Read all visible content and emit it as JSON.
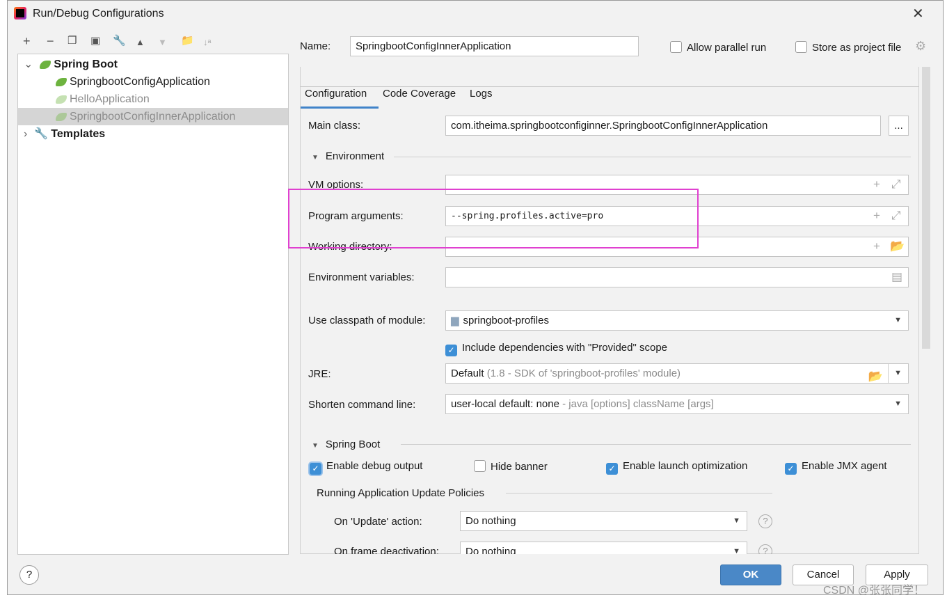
{
  "window": {
    "title": "Run/Debug Configurations"
  },
  "toolbar": [
    "add-icon",
    "remove-icon",
    "copy-icon",
    "save-icon",
    "wrench-icon",
    "move-up-icon",
    "move-down-icon",
    "new-folder-icon",
    "sort-icon"
  ],
  "tree": {
    "group": "Spring Boot",
    "items": [
      "SpringbootConfigApplication",
      "HelloApplication",
      "SpringbootConfigInnerApplication"
    ],
    "templates": "Templates"
  },
  "name": {
    "label": "Name:",
    "value": "SpringbootConfigInnerApplication"
  },
  "allow_parallel": {
    "label": "Allow parallel run",
    "checked": false
  },
  "store_project": {
    "label": "Store as project file",
    "checked": false
  },
  "tabs": [
    "Configuration",
    "Code Coverage",
    "Logs"
  ],
  "main_class": {
    "label": "Main class:",
    "value": "com.itheima.springbootconfiginner.SpringbootConfigInnerApplication",
    "browse": "..."
  },
  "environment": {
    "title": "Environment",
    "vm_label": "VM options:",
    "vm_value": "",
    "args_label": "Program arguments:",
    "args_value": "--spring.profiles.active=pro",
    "wd_label": "Working directory:",
    "wd_value": "",
    "env_label": "Environment variables:",
    "env_value": ""
  },
  "classpath": {
    "label": "Use classpath of module:",
    "value": "springboot-profiles"
  },
  "include_deps": {
    "label": "Include dependencies with \"Provided\" scope",
    "checked": true
  },
  "jre": {
    "label": "JRE:",
    "value": "Default",
    "hint": "(1.8 - SDK of 'springboot-profiles' module)"
  },
  "shorten": {
    "label": "Shorten command line:",
    "value": "user-local default: none",
    "hint": "- java [options] className [args]"
  },
  "spring_boot": {
    "title": "Spring Boot",
    "debug": {
      "label": "Enable debug output",
      "checked": true
    },
    "hide_banner": {
      "label": "Hide banner",
      "checked": false
    },
    "launch_opt": {
      "label": "Enable launch optimization",
      "checked": true
    },
    "jmx": {
      "label": "Enable JMX agent",
      "checked": true
    },
    "policies_title": "Running Application Update Policies",
    "update_label": "On 'Update' action:",
    "update_value": "Do nothing",
    "frame_label": "On frame deactivation:",
    "frame_value": "Do nothing"
  },
  "buttons": {
    "ok": "OK",
    "cancel": "Cancel",
    "apply": "Apply",
    "help": "?"
  },
  "watermark": "CSDN @张张同学！",
  "highlight_color": "#e040d0"
}
